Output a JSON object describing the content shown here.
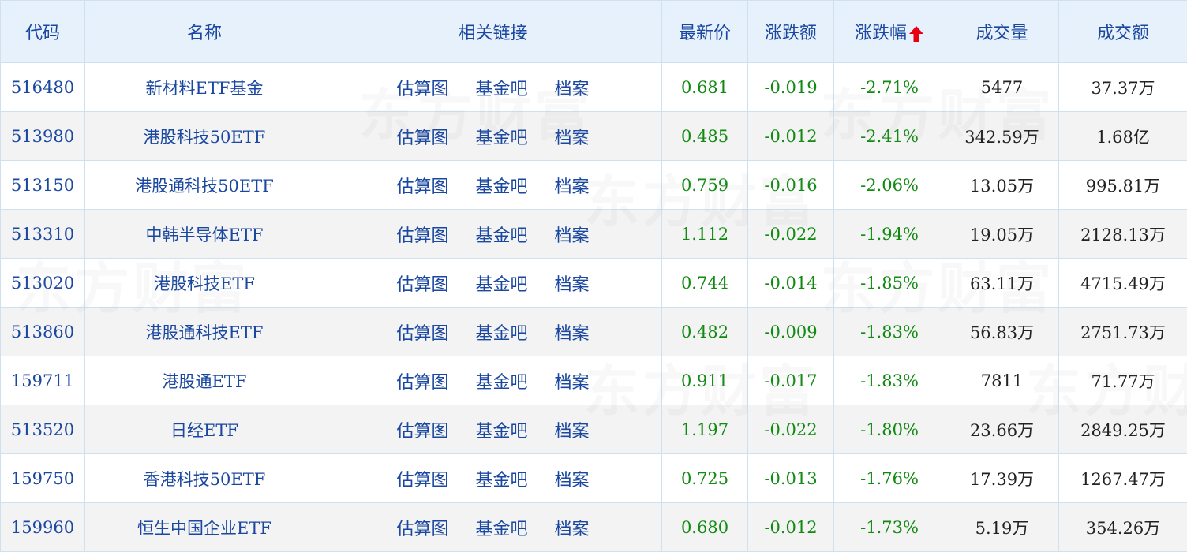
{
  "columns": {
    "code": "代码",
    "name": "名称",
    "links": "相关链接",
    "price": "最新价",
    "change": "涨跌额",
    "change_pct": "涨跌幅",
    "volume": "成交量",
    "amount": "成交额"
  },
  "sort": {
    "column": "change_pct",
    "icon": "sort-up-arrow-icon",
    "color": "#e60012"
  },
  "link_labels": [
    "估算图",
    "基金吧",
    "档案"
  ],
  "watermark": "东方财富",
  "colors": {
    "header_bg": "#e7f1fb",
    "link": "#1a47a0",
    "down": "#118a11",
    "row_alt": "#f3f3f3"
  },
  "rows": [
    {
      "code": "516480",
      "name": "新材料ETF基金",
      "price": "0.681",
      "change": "-0.019",
      "change_pct": "-2.71%",
      "volume": "5477",
      "amount": "37.37万"
    },
    {
      "code": "513980",
      "name": "港股科技50ETF",
      "price": "0.485",
      "change": "-0.012",
      "change_pct": "-2.41%",
      "volume": "342.59万",
      "amount": "1.68亿"
    },
    {
      "code": "513150",
      "name": "港股通科技50ETF",
      "price": "0.759",
      "change": "-0.016",
      "change_pct": "-2.06%",
      "volume": "13.05万",
      "amount": "995.81万"
    },
    {
      "code": "513310",
      "name": "中韩半导体ETF",
      "price": "1.112",
      "change": "-0.022",
      "change_pct": "-1.94%",
      "volume": "19.05万",
      "amount": "2128.13万"
    },
    {
      "code": "513020",
      "name": "港股科技ETF",
      "price": "0.744",
      "change": "-0.014",
      "change_pct": "-1.85%",
      "volume": "63.11万",
      "amount": "4715.49万"
    },
    {
      "code": "513860",
      "name": "港股通科技ETF",
      "price": "0.482",
      "change": "-0.009",
      "change_pct": "-1.83%",
      "volume": "56.83万",
      "amount": "2751.73万"
    },
    {
      "code": "159711",
      "name": "港股通ETF",
      "price": "0.911",
      "change": "-0.017",
      "change_pct": "-1.83%",
      "volume": "7811",
      "amount": "71.77万"
    },
    {
      "code": "513520",
      "name": "日经ETF",
      "price": "1.197",
      "change": "-0.022",
      "change_pct": "-1.80%",
      "volume": "23.66万",
      "amount": "2849.25万"
    },
    {
      "code": "159750",
      "name": "香港科技50ETF",
      "price": "0.725",
      "change": "-0.013",
      "change_pct": "-1.76%",
      "volume": "17.39万",
      "amount": "1267.47万"
    },
    {
      "code": "159960",
      "name": "恒生中国企业ETF",
      "price": "0.680",
      "change": "-0.012",
      "change_pct": "-1.73%",
      "volume": "5.19万",
      "amount": "354.26万"
    }
  ]
}
